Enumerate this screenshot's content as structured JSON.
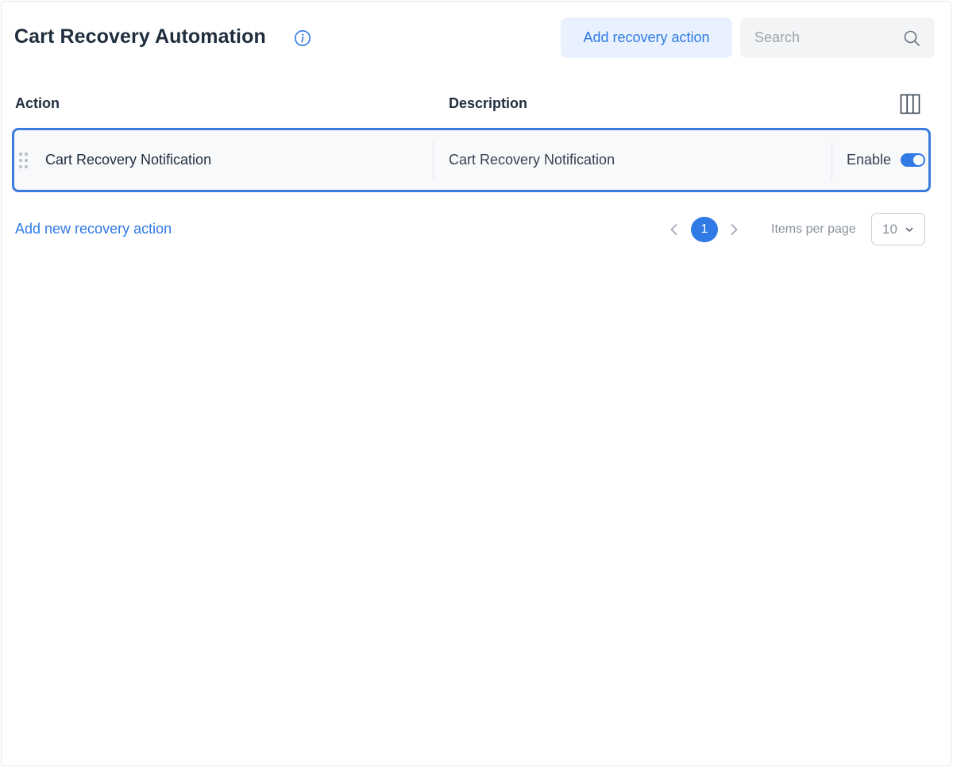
{
  "header": {
    "title": "Cart Recovery Automation",
    "add_button_label": "Add recovery action",
    "search_placeholder": "Search"
  },
  "table": {
    "columns": [
      "Action",
      "Description"
    ],
    "rows": [
      {
        "action": "Cart Recovery Notification",
        "description": "Cart Recovery Notification",
        "status_label": "Enable",
        "enabled": true
      }
    ]
  },
  "footer": {
    "add_link_label": "Add new recovery action",
    "current_page": "1",
    "items_per_page_label": "Items per page",
    "items_per_page_value": "10"
  },
  "colors": {
    "accent": "#2f7ae5",
    "row_border": "#3b7be0",
    "button_bg": "#e8f1fd"
  },
  "icons": [
    "info-icon",
    "search-icon",
    "columns-icon",
    "drag-handle-icon",
    "chevron-left-icon",
    "chevron-right-icon",
    "chevron-down-icon"
  ]
}
